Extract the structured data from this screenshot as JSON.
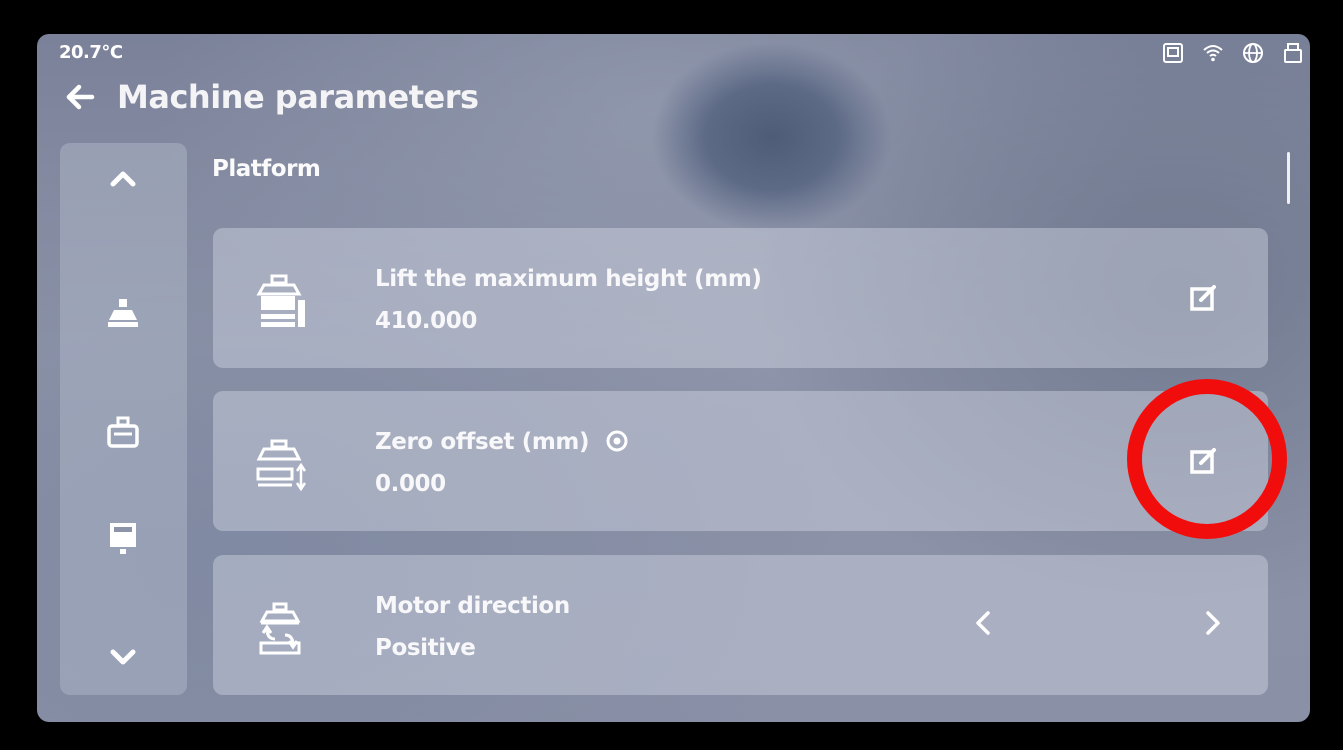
{
  "status_bar": {
    "temperature": "20.7°C",
    "icons": [
      "storage-icon",
      "wifi-icon",
      "globe-icon",
      "usb-icon"
    ]
  },
  "header": {
    "back_icon": "back-arrow-icon",
    "title": "Machine parameters"
  },
  "sidebar": {
    "items": [
      {
        "icon": "chevron-up-icon"
      },
      {
        "icon": "platform-icon"
      },
      {
        "icon": "vat-icon"
      },
      {
        "icon": "printer-icon"
      },
      {
        "icon": "chevron-down-icon"
      }
    ]
  },
  "section": {
    "title": "Platform"
  },
  "params": [
    {
      "label": "Lift the maximum height (mm)",
      "value": "410.000",
      "icon": "lift-height-icon",
      "action": "edit-icon"
    },
    {
      "label": "Zero offset (mm)",
      "value": "0.000",
      "icon": "zero-offset-icon",
      "help_icon": "help-icon",
      "action": "edit-icon"
    },
    {
      "label": "Motor direction",
      "value": "Positive",
      "icon": "motor-direction-icon",
      "prev": "chevron-left-icon",
      "next": "chevron-right-icon"
    }
  ],
  "colors": {
    "highlight": "#f20d0d",
    "text": "#f8f8fa"
  }
}
